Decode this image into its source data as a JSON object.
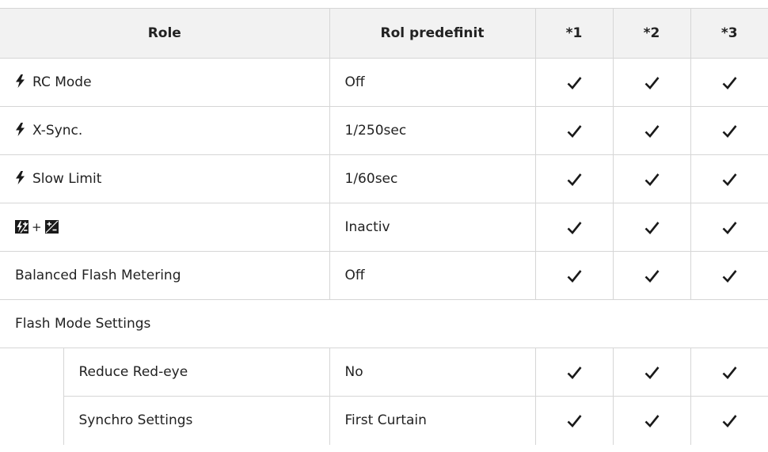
{
  "table": {
    "headers": {
      "role": "Role",
      "default": "Rol predefinit",
      "c1": "*1",
      "c2": "*2",
      "c3": "*3"
    },
    "rows": [
      {
        "label": "RC Mode",
        "icon": "flash-icon",
        "value": "Off",
        "c1": true,
        "c2": true,
        "c3": true
      },
      {
        "label": "X-Sync.",
        "icon": "flash-icon",
        "value": "1/250sec",
        "c1": true,
        "c2": true,
        "c3": true
      },
      {
        "label": "Slow Limit",
        "icon": "flash-icon",
        "value": "1/60sec",
        "c1": true,
        "c2": true,
        "c3": true
      },
      {
        "label": "",
        "icon": "flash-exposure-comp-plus-exposure-comp-icon",
        "value": "Inactiv",
        "c1": true,
        "c2": true,
        "c3": true
      },
      {
        "label": "Balanced Flash Metering",
        "value": "Off",
        "c1": true,
        "c2": true,
        "c3": true
      }
    ],
    "group": {
      "label": "Flash Mode Settings",
      "rows": [
        {
          "label": "Reduce Red-eye",
          "value": "No",
          "c1": true,
          "c2": true,
          "c3": true
        },
        {
          "label": "Synchro Settings",
          "value": "First Curtain",
          "c1": true,
          "c2": true,
          "c3": true
        }
      ]
    }
  },
  "colors": {
    "header_bg": "#f2f2f2",
    "border": "#d6d6d6",
    "text": "#222222",
    "icon": "#1a1a1a"
  },
  "check_mark": "check-icon"
}
